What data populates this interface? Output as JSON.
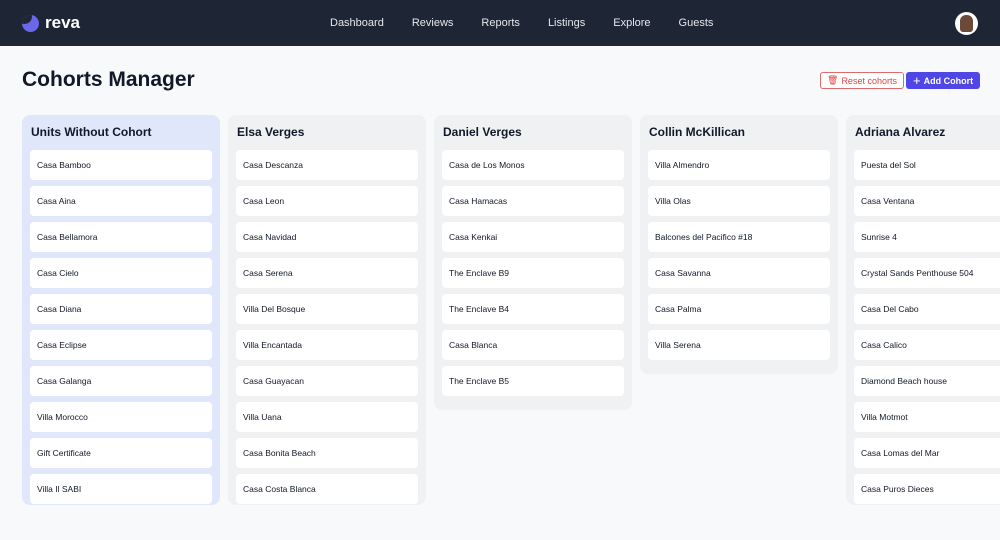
{
  "brand": "reva",
  "nav": [
    "Dashboard",
    "Reviews",
    "Reports",
    "Listings",
    "Explore",
    "Guests"
  ],
  "page_title": "Cohorts Manager",
  "reset_label": "Reset cohorts",
  "add_label": "Add Cohort",
  "columns": [
    {
      "title": "Units Without Cohort",
      "units": [
        "Casa Bamboo",
        "Casa Aina",
        "Casa Bellamora",
        "Casa Cielo",
        "Casa Diana",
        "Casa Eclipse",
        "Casa Galanga",
        "Villa Morocco",
        "Gift Certificate",
        "Villa Il SABI"
      ]
    },
    {
      "title": "Elsa Verges",
      "units": [
        "Casa Descanza",
        "Casa Leon",
        "Casa Navidad",
        "Casa Serena",
        "Villa Del Bosque",
        "Villa Encantada",
        "Casa Guayacan",
        "Villa Uana",
        "Casa Bonita Beach",
        "Casa Costa Blanca"
      ]
    },
    {
      "title": "Daniel Verges",
      "units": [
        "Casa de Los Monos",
        "Casa Hamacas",
        "Casa Kenkai",
        "The Enclave B9",
        "The Enclave B4",
        "Casa Blanca",
        "The Enclave B5"
      ]
    },
    {
      "title": "Collin McKillican",
      "units": [
        "Villa Almendro",
        "Villa Olas",
        "Balcones del Pacifico #18",
        "Casa Savanna",
        "Casa Palma",
        "Villa Serena"
      ]
    },
    {
      "title": "Adriana Alvarez",
      "units": [
        "Puesta del Sol",
        "Casa Ventana",
        "Sunrise 4",
        "Crystal Sands Penthouse 504",
        "Casa Del Cabo",
        "Casa Calico",
        "Diamond Beach house",
        "Villa Motmot",
        "Casa Lomas del Mar",
        "Casa Puros Dieces"
      ]
    }
  ]
}
